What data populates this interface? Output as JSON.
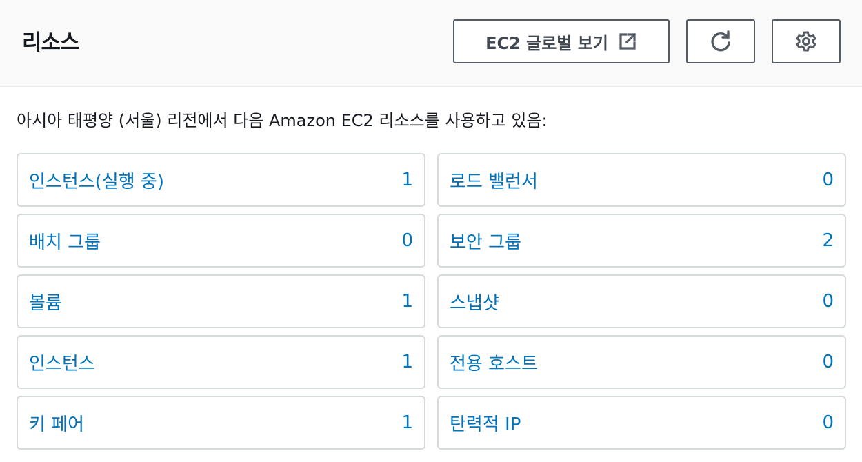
{
  "header": {
    "title": "리소스",
    "global_view_label": "EC2 글로벌 보기",
    "icons": {
      "external": "external-link-icon",
      "refresh": "refresh-icon",
      "settings": "gear-icon"
    }
  },
  "description": "아시아 태평양 (서울) 리전에서 다음 Amazon EC2 리소스를 사용하고 있음:",
  "resources": [
    {
      "label": "인스턴스(실행 중)",
      "count": "1"
    },
    {
      "label": "로드 밸런서",
      "count": "0"
    },
    {
      "label": "배치 그룹",
      "count": "0"
    },
    {
      "label": "보안 그룹",
      "count": "2"
    },
    {
      "label": "볼륨",
      "count": "1"
    },
    {
      "label": "스냅샷",
      "count": "0"
    },
    {
      "label": "인스턴스",
      "count": "1"
    },
    {
      "label": "전용 호스트",
      "count": "0"
    },
    {
      "label": "키 페어",
      "count": "1"
    },
    {
      "label": "탄력적 IP",
      "count": "0"
    }
  ],
  "colors": {
    "link": "#0073bb",
    "button_border": "#545b64",
    "card_border": "#d5dbdb",
    "header_bg": "#fafafa"
  }
}
